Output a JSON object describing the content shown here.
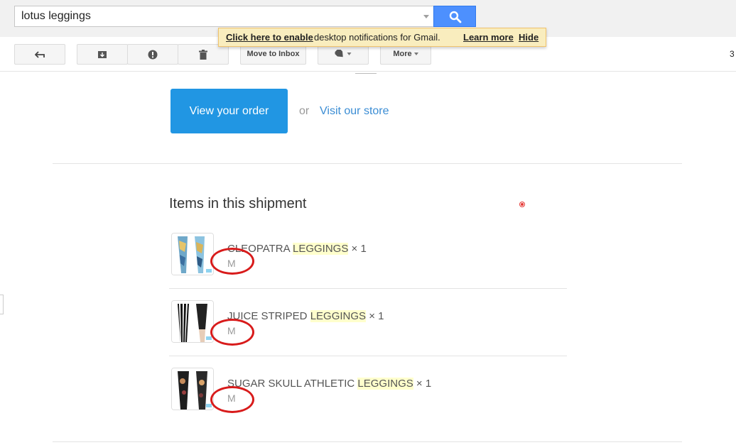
{
  "search": {
    "value": "lotus leggings"
  },
  "notification": {
    "enable_link": "Click here to enable",
    "message": " desktop notifications for Gmail.",
    "learn_more": "Learn more",
    "hide": "Hide"
  },
  "toolbar": {
    "move_to_inbox": "Move to Inbox",
    "more": "More",
    "count": "3"
  },
  "email": {
    "view_order_button": "View your order",
    "or_text": "or",
    "visit_store_link": "Visit our store",
    "items_heading": "Items in this shipment",
    "items": [
      {
        "name_prefix": "CLEOPATRA ",
        "highlight": "LEGGINGS",
        "qty": " × 1",
        "size": "M"
      },
      {
        "name_prefix": "JUICE STRIPED ",
        "highlight": "LEGGINGS",
        "qty": " × 1",
        "size": "M"
      },
      {
        "name_prefix": "SUGAR SKULL ATHLETIC ",
        "highlight": "LEGGINGS",
        "qty": " × 1",
        "size": "M"
      }
    ]
  },
  "colors": {
    "primary_button": "#2196e3",
    "search_button": "#4d90fe",
    "notification_bg": "#f9edbe",
    "annotation_circle": "#d81b1b",
    "search_highlight": "#ffffcc"
  }
}
